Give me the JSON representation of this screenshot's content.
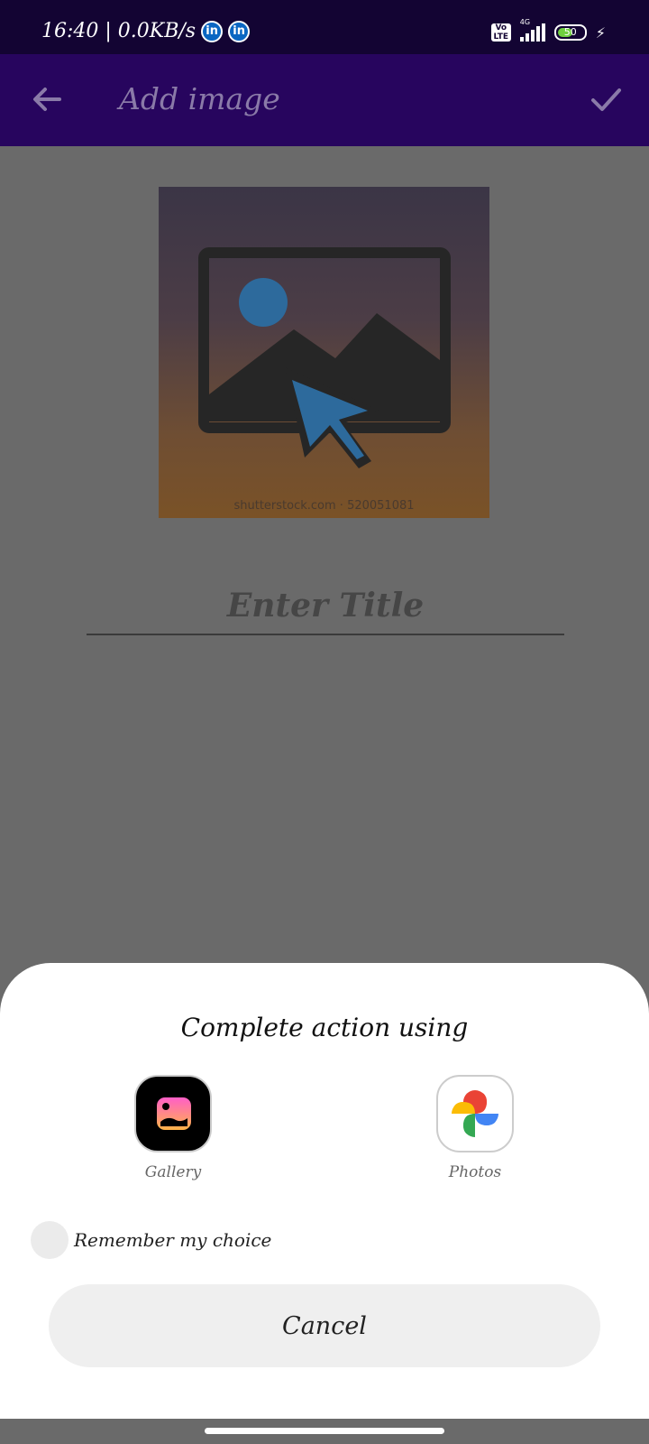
{
  "status_bar": {
    "time_speed": "16:40 | 0.0KB/s",
    "linkedin_icon": "in",
    "volte": "Vo LTE",
    "network": "4G",
    "battery": "50"
  },
  "app_bar": {
    "title": "Add image"
  },
  "image": {
    "watermark": "shutterstock.com · 520051081"
  },
  "form": {
    "title_placeholder": "Enter Title"
  },
  "sheet": {
    "title": "Complete action using",
    "apps": [
      {
        "label": "Gallery",
        "icon": "gallery-icon"
      },
      {
        "label": "Photos",
        "icon": "google-photos-icon"
      }
    ],
    "remember_label": "Remember my choice",
    "cancel_label": "Cancel"
  }
}
